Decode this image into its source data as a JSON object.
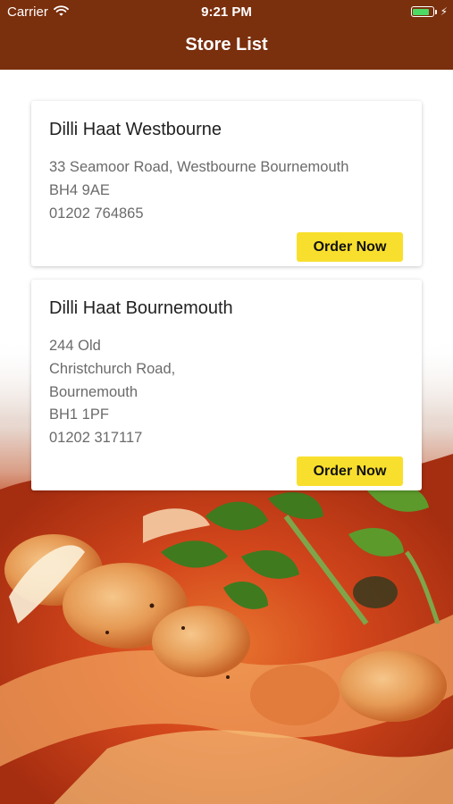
{
  "status_bar": {
    "carrier": "Carrier",
    "time": "9:21 PM",
    "battery_level": 0.85,
    "charging": true
  },
  "nav": {
    "title": "Store List"
  },
  "stores": [
    {
      "name": "Dilli Haat Westbourne",
      "address_lines": [
        "33 Seamoor Road, Westbourne Bournemouth",
        "BH4 9AE"
      ],
      "phone": "01202 764865",
      "button_label": "Order Now"
    },
    {
      "name": "Dilli Haat Bournemouth",
      "address_lines": [
        "244 Old",
        "Christchurch Road,",
        "Bournemouth",
        "BH1 1PF"
      ],
      "phone": "01202 317117",
      "button_label": "Order Now"
    }
  ],
  "colors": {
    "nav_bg": "#7a2f0d",
    "button_bg": "#f9df2d",
    "battery": "#4cd964"
  }
}
